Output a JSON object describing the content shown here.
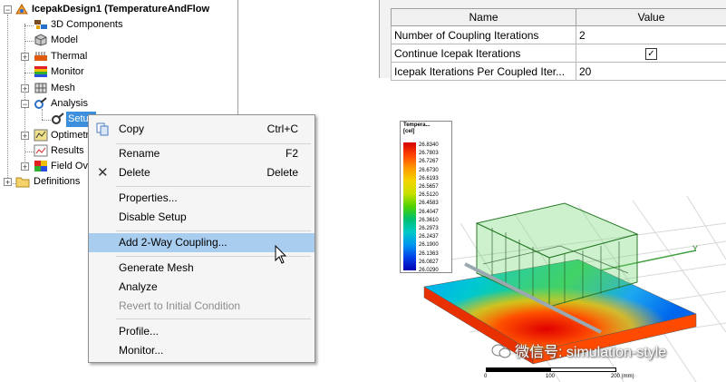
{
  "tree": {
    "root": "IcepakDesign1 (TemperatureAndFlow",
    "items": [
      "3D Components",
      "Model",
      "Thermal",
      "Monitor",
      "Mesh",
      "Analysis",
      "Setup",
      "Optimetr",
      "Results",
      "Field Ove",
      "Definitions"
    ]
  },
  "menu": {
    "items": [
      {
        "label": "Copy",
        "shortcut": "Ctrl+C"
      },
      {
        "label": "Rename",
        "shortcut": "F2"
      },
      {
        "label": "Delete",
        "shortcut": "Delete"
      },
      {
        "label": "Properties..."
      },
      {
        "label": "Disable Setup"
      },
      {
        "label": "Add 2-Way Coupling..."
      },
      {
        "label": "Generate Mesh"
      },
      {
        "label": "Analyze"
      },
      {
        "label": "Revert to Initial Condition"
      },
      {
        "label": "Profile..."
      },
      {
        "label": "Monitor..."
      }
    ]
  },
  "properties": {
    "headers": {
      "name": "Name",
      "value": "Value"
    },
    "rows": [
      {
        "name": "Number of Coupling Iterations",
        "value": "2"
      },
      {
        "name": "Continue Icepak Iterations",
        "value": "✓"
      },
      {
        "name": "Icepak Iterations Per Coupled Iter...",
        "value": "20"
      }
    ]
  },
  "view": {
    "legend_title_line1": "Tempera...",
    "legend_title_line2": "[cel]",
    "legend_values": [
      "26.8340",
      "26.7803",
      "26.7267",
      "26.6730",
      "26.6193",
      "26.5657",
      "26.5120",
      "26.4583",
      "26.4047",
      "26.3610",
      "26.2973",
      "26.2437",
      "26.1900",
      "26.1363",
      "26.0827",
      "26.0290"
    ],
    "axis_y": "Y",
    "watermark": "微信号: simulation-style",
    "scale": {
      "tick0": "0",
      "tick1": "100",
      "tick2": "200 (mm)"
    }
  },
  "colors": {
    "highlight": "#a8cdef",
    "menu_bg": "#f5f5f5",
    "hot": "#d50000",
    "cold": "#0000b0"
  }
}
